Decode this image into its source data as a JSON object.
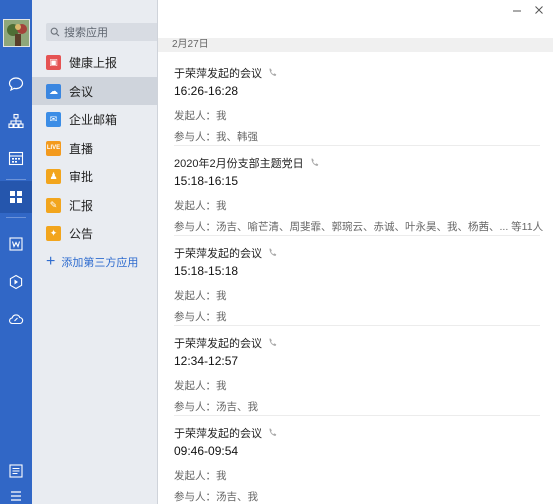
{
  "panel": {
    "search_placeholder": "搜索应用",
    "apps": [
      {
        "label": "健康上报",
        "icon": "health-report-icon",
        "color": "#e55353",
        "glyph": "▣"
      },
      {
        "label": "会议",
        "icon": "meeting-cloud-icon",
        "color": "#3a86e0",
        "glyph": "☁"
      },
      {
        "label": "企业邮箱",
        "icon": "mail-icon",
        "color": "#3c8de6",
        "glyph": "✉"
      },
      {
        "label": "直播",
        "icon": "live-icon",
        "color": "#f39a1e",
        "glyph": "LIVE"
      },
      {
        "label": "审批",
        "icon": "approval-icon",
        "color": "#f2a51d",
        "glyph": "♟"
      },
      {
        "label": "汇报",
        "icon": "report-icon",
        "color": "#f2a51d",
        "glyph": "✎"
      },
      {
        "label": "公告",
        "icon": "announcement-icon",
        "color": "#f2a51d",
        "glyph": "✦"
      }
    ],
    "add_app_label": "添加第三方应用"
  },
  "main": {
    "date": "2月27日",
    "meetings": [
      {
        "title": "于荣萍发起的会议",
        "time": "16:26-16:28",
        "initiator": "发起人：我",
        "participants": "参与人：我、韩强"
      },
      {
        "title": "2020年2月份支部主题党日",
        "time": "15:18-16:15",
        "initiator": "发起人：我",
        "participants": "参与人：汤吉、喻芒清、周斐霏、郭琬云、赤诚、叶永昊、我、杨茜、... 等11人"
      },
      {
        "title": "于荣萍发起的会议",
        "time": "15:18-15:18",
        "initiator": "发起人：我",
        "participants": "参与人：我"
      },
      {
        "title": "于荣萍发起的会议",
        "time": "12:34-12:57",
        "initiator": "发起人：我",
        "participants": "参与人：汤吉、我"
      },
      {
        "title": "于荣萍发起的会议",
        "time": "09:46-09:54",
        "initiator": "发起人：我",
        "participants": "参与人：汤吉、我"
      }
    ]
  }
}
